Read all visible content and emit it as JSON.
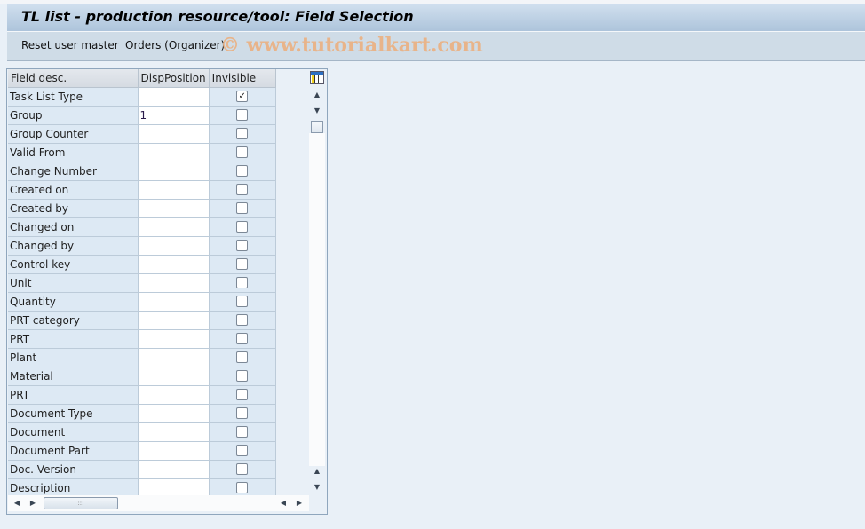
{
  "window": {
    "title": "TL list - production resource/tool: Field Selection"
  },
  "toolbar": {
    "reset_label": "Reset user master",
    "orders_label": "Orders (Organizer)",
    "watermark": "© www.tutorialkart.com"
  },
  "grid": {
    "columns": [
      "Field desc.",
      "DispPosition",
      "Invisible"
    ],
    "rows": [
      {
        "desc": "Task List Type",
        "position": "",
        "invisible": true
      },
      {
        "desc": "Group",
        "position": "1",
        "invisible": false
      },
      {
        "desc": "Group Counter",
        "position": "",
        "invisible": false
      },
      {
        "desc": "Valid From",
        "position": "",
        "invisible": false
      },
      {
        "desc": "Change Number",
        "position": "",
        "invisible": false
      },
      {
        "desc": "Created on",
        "position": "",
        "invisible": false
      },
      {
        "desc": "Created by",
        "position": "",
        "invisible": false
      },
      {
        "desc": "Changed on",
        "position": "",
        "invisible": false
      },
      {
        "desc": "Changed by",
        "position": "",
        "invisible": false
      },
      {
        "desc": "Control key",
        "position": "",
        "invisible": false
      },
      {
        "desc": "Unit",
        "position": "",
        "invisible": false
      },
      {
        "desc": "Quantity",
        "position": "",
        "invisible": false
      },
      {
        "desc": "PRT category",
        "position": "",
        "invisible": false
      },
      {
        "desc": "PRT",
        "position": "",
        "invisible": false
      },
      {
        "desc": "Plant",
        "position": "",
        "invisible": false
      },
      {
        "desc": "Material",
        "position": "",
        "invisible": false
      },
      {
        "desc": "PRT",
        "position": "",
        "invisible": false
      },
      {
        "desc": "Document Type",
        "position": "",
        "invisible": false
      },
      {
        "desc": "Document",
        "position": "",
        "invisible": false
      },
      {
        "desc": "Document Part",
        "position": "",
        "invisible": false
      },
      {
        "desc": "Doc. Version",
        "position": "",
        "invisible": false
      },
      {
        "desc": "Description",
        "position": "",
        "invisible": false
      }
    ]
  },
  "icons": {
    "config": "table-settings-icon",
    "up": "▲",
    "down": "▼",
    "left": "◀",
    "right": "▶",
    "grip": ":::",
    "check": "✓"
  }
}
